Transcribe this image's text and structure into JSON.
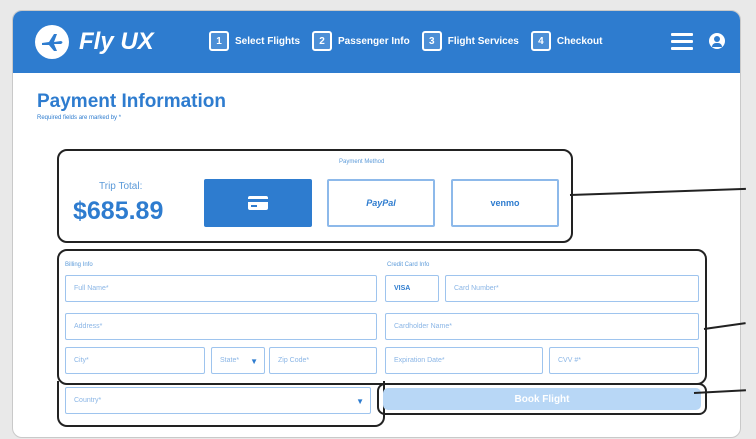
{
  "header": {
    "brand": "Fly UX",
    "steps": [
      {
        "num": "1",
        "label": "Select Flights"
      },
      {
        "num": "2",
        "label": "Passenger Info"
      },
      {
        "num": "3",
        "label": "Flight Services"
      },
      {
        "num": "4",
        "label": "Checkout"
      }
    ]
  },
  "page": {
    "title": "Payment Information",
    "subtitle": "Required fields are marked by *"
  },
  "payment": {
    "method_label": "Payment Method",
    "trip_total_label": "Trip Total:",
    "trip_total": "$685.89",
    "paypal_label": "PayPal",
    "venmo_label": "venmo"
  },
  "billing": {
    "label": "Billing Info",
    "full_name": "Full Name*",
    "address": "Address*",
    "city": "City*",
    "state": "State*",
    "zip": "Zip Code*",
    "country": "Country*"
  },
  "credit": {
    "label": "Credit Card Info",
    "visa": "VISA",
    "card_number": "Card Number*",
    "cardholder": "Cardholder Name*",
    "expiration": "Expiration Date*",
    "cvv": "CVV #*"
  },
  "actions": {
    "book": "Book Flight"
  },
  "colors": {
    "brand_blue": "#2e7ccf",
    "light_blue": "#b8d7f6"
  }
}
